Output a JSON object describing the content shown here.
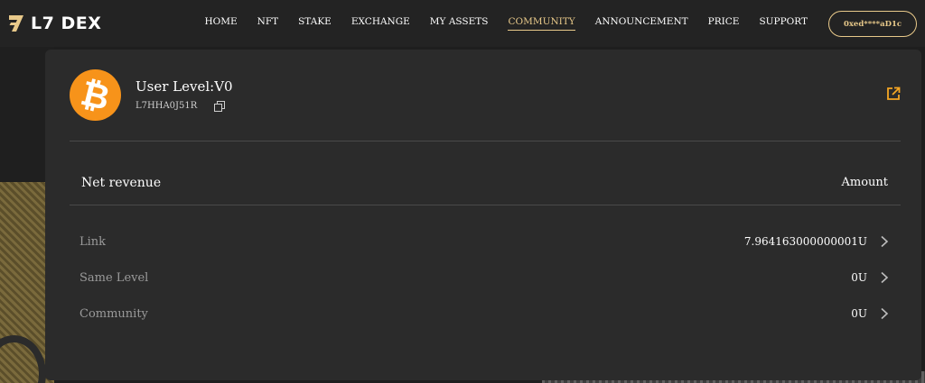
{
  "brand": {
    "name": "L7 DEX",
    "logo_icon": "l7-logo-icon",
    "accent": "#e8c98a"
  },
  "nav": [
    {
      "label": "HOME",
      "active": false
    },
    {
      "label": "NFT",
      "active": false
    },
    {
      "label": "STAKE",
      "active": false
    },
    {
      "label": "EXCHANGE",
      "active": false
    },
    {
      "label": "MY ASSETS",
      "active": false
    },
    {
      "label": "COMMUNITY",
      "active": true
    },
    {
      "label": "ANNOUNCEMENT",
      "active": false
    },
    {
      "label": "PRICE",
      "active": false
    },
    {
      "label": "SUPPORT",
      "active": false
    }
  ],
  "wallet": {
    "address": "0xed****aD1c"
  },
  "profile": {
    "avatar_icon": "bitcoin-icon",
    "avatar_color": "#f7931a",
    "level": "User Level:V0",
    "user_id": "L7HHA0J51R"
  },
  "table": {
    "header_left": "Net revenue",
    "header_right": "Amount",
    "rows": [
      {
        "label": "Link",
        "value": "7.964163000000001U"
      },
      {
        "label": "Same Level",
        "value": "0U"
      },
      {
        "label": "Community",
        "value": "0U"
      }
    ]
  }
}
